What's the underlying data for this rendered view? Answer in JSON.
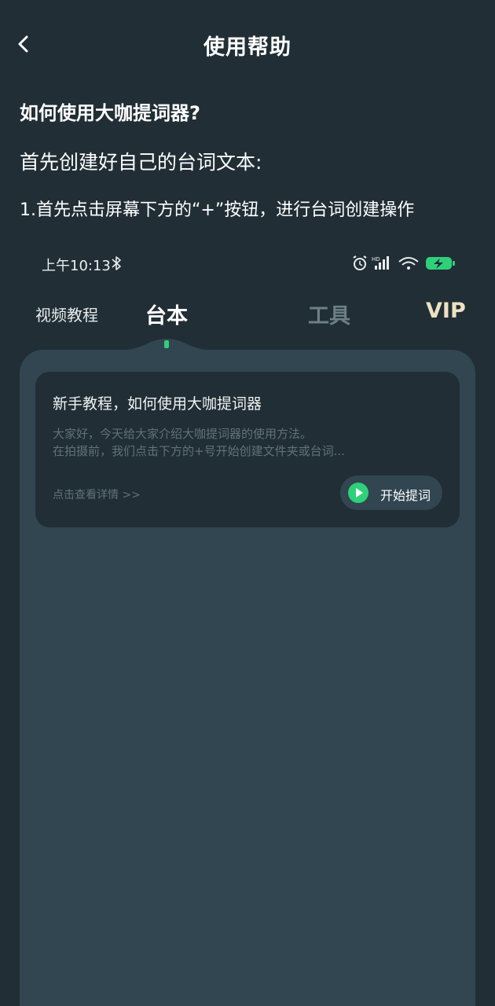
{
  "nav": {
    "title": "使用帮助",
    "back_icon": "chevron-left-icon"
  },
  "help": {
    "heading": "如何使用大咖提词器?",
    "subheading": "首先创建好自己的台词文本:",
    "step1": "1.首先点击屏幕下方的“+”按钮，进行台词创建操作"
  },
  "screenshot": {
    "status_bar": {
      "time": "上午10:13",
      "icons": [
        "bluetooth-icon",
        "alarm-icon",
        "hd-signal-icon",
        "wifi-icon",
        "battery-charging-icon"
      ],
      "hd_label": "HD"
    },
    "tabs": [
      {
        "label": "视频教程"
      },
      {
        "label": "台本",
        "active": true
      },
      {
        "label": "工具"
      },
      {
        "label": "VIP"
      }
    ],
    "card": {
      "title": "新手教程，如何使用大咖提词器",
      "description": "大家好，今天给大家介绍大咖提词器的使用方法。\n 在拍摄前，我们点击下方的+号开始创建文件夹或台词...",
      "detail_link": "点击查看详情 >>",
      "start_button": "开始提词",
      "start_icon": "play-circle-icon"
    }
  },
  "colors": {
    "background": "#212e35",
    "panel": "#314651",
    "accent": "#2fd07a",
    "vip": "#ede1c2",
    "muted": "#5f727a"
  }
}
